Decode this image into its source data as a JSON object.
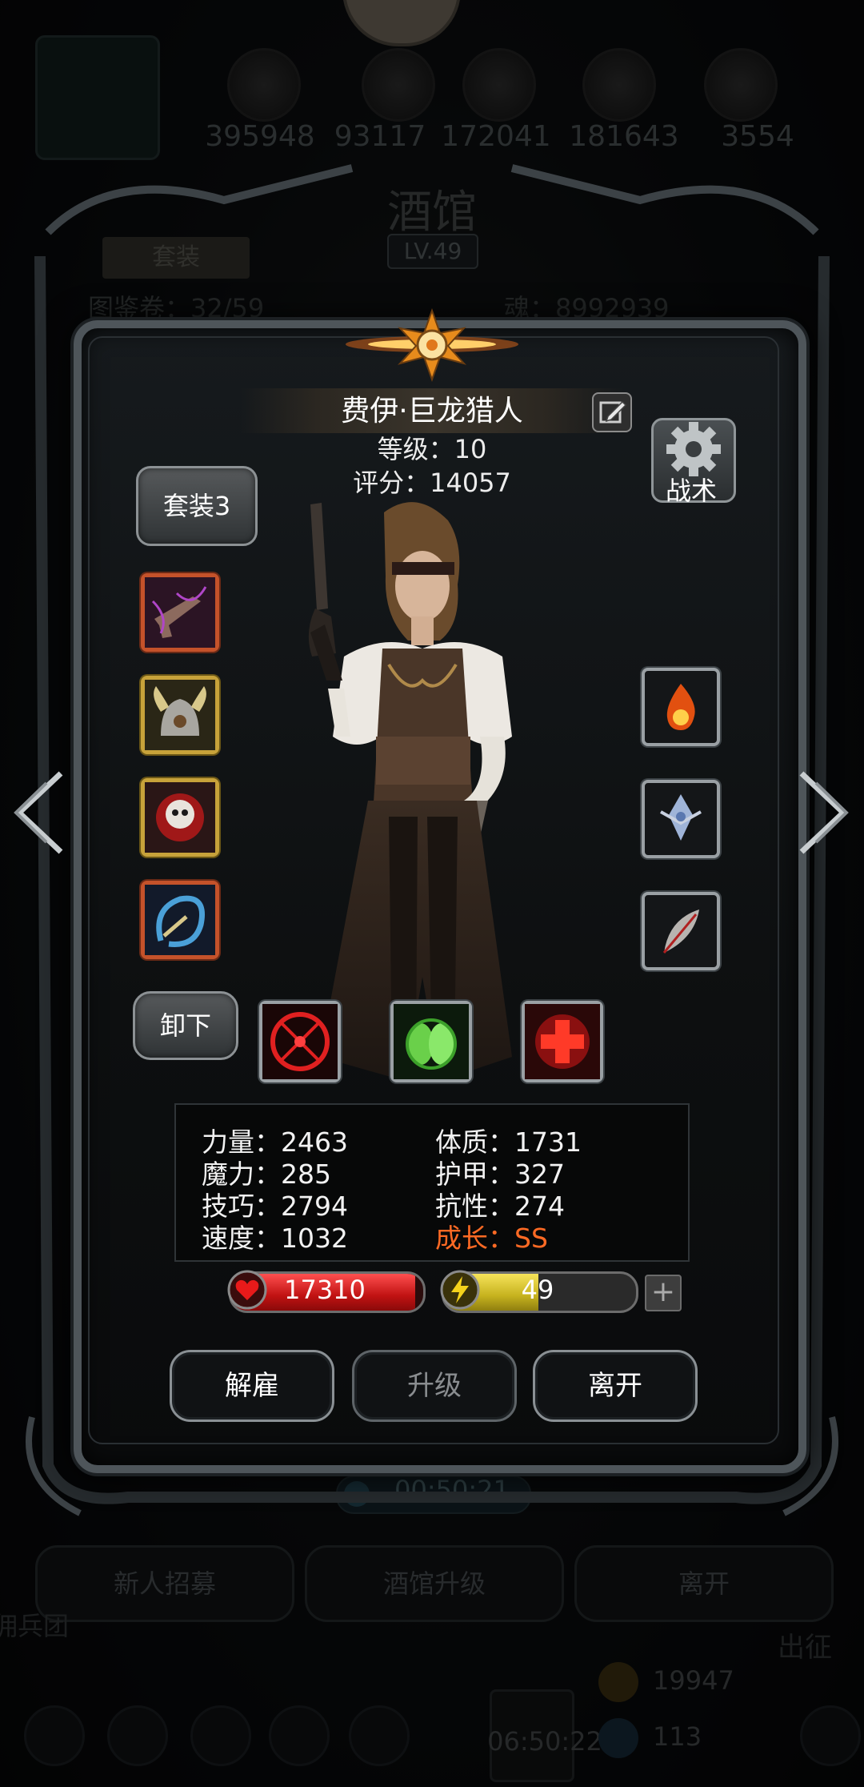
{
  "background": {
    "resources": [
      "395948",
      "93117",
      "172041",
      "181643",
      "3554"
    ],
    "title": "酒馆",
    "level": "LV.49",
    "tab": "套装",
    "hidden_left": "图鉴卷：32/59",
    "hidden_right": "魂：8992939",
    "timer": "00:50:21",
    "buttons": [
      "新人招募",
      "酒馆升级",
      "离开"
    ],
    "side_left": "佣兵团",
    "side_right": "出征",
    "bottom_timer": "06:50:22",
    "bottom_count_1": "19947",
    "bottom_count_2": "113"
  },
  "hero": {
    "name": "费伊·巨龙猎人",
    "level_text": "等级：10",
    "score_text": "评分：14057",
    "suit_button": "套装3",
    "tactics_button": "战术",
    "unequip_button": "卸下"
  },
  "equipment_left": [
    "pistol-icon",
    "horned-helmet-icon",
    "skull-medallion-icon",
    "chain-whip-icon"
  ],
  "equipment_right": [
    "fire-orb-icon",
    "crystal-crest-icon",
    "feather-icon"
  ],
  "skills": [
    "crosshair-skill-icon",
    "green-shield-skill-icon",
    "red-cross-skill-icon"
  ],
  "stats": [
    {
      "label": "力量：2463"
    },
    {
      "label": "体质：1731"
    },
    {
      "label": "魔力：285"
    },
    {
      "label": "护甲：327"
    },
    {
      "label": "技巧：2794"
    },
    {
      "label": "抗性：274"
    },
    {
      "label": "速度：1032"
    },
    {
      "label": "成长：SS",
      "color": "#ff6a24"
    }
  ],
  "hp": {
    "value": "17310",
    "fill": 0.96
  },
  "energy": {
    "value": "49",
    "fill": 0.49
  },
  "actions": {
    "dismiss": "解雇",
    "upgrade": "升级",
    "leave": "离开"
  },
  "colors": {
    "hp": "#d81818",
    "energy": "#e0cc30",
    "growth": "#ff6a24"
  }
}
